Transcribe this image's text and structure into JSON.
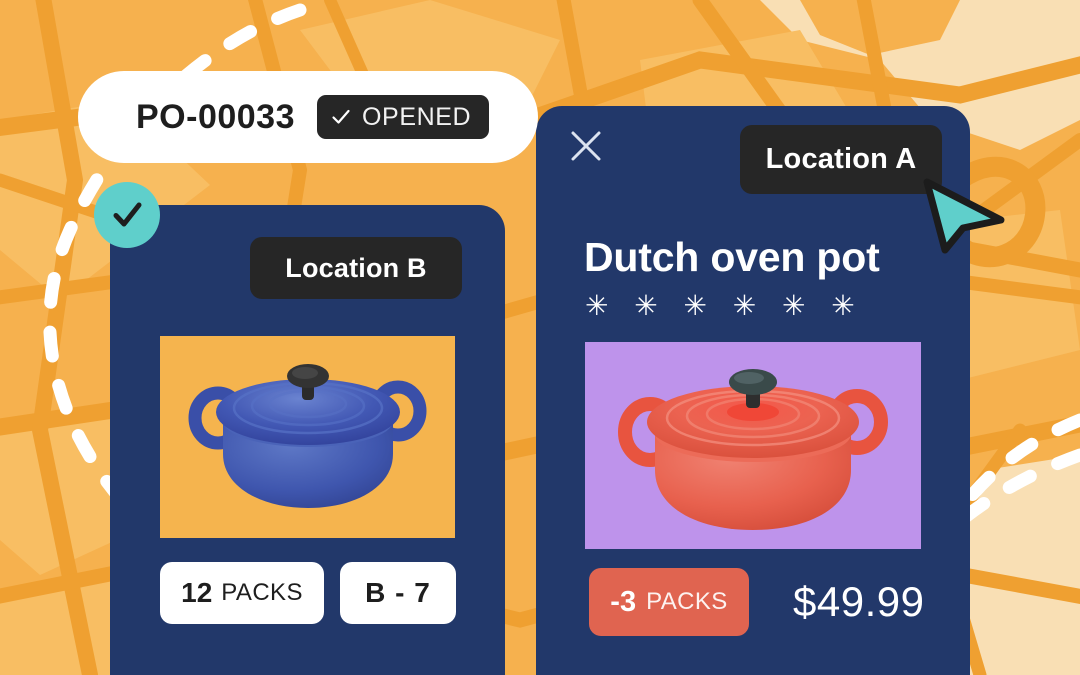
{
  "header": {
    "po_number": "PO-00033",
    "status_label": "OPENED",
    "status_icon": "check-icon",
    "status_bg": "#262626",
    "banner_bg": "#FFFFFF"
  },
  "cursor": {
    "icon": "cursor-arrow-icon",
    "fill": "#5FCFCB",
    "stroke": "#1C1C1C"
  },
  "check_marker": {
    "icon": "check-icon",
    "bg": "#5FCFCB",
    "stroke": "#1E1E1E"
  },
  "map": {
    "base_color": "#F6B14E",
    "road_color": "#EFA031",
    "block_color": "#F8BE63",
    "land_color": "#F9DFB4",
    "route_color": "#FFFFFF"
  },
  "cards": [
    {
      "id": "location-b",
      "location_label": "Location B",
      "bg": "#22386A",
      "image": {
        "name": "blue-dutch-oven-photo",
        "frame_bg": "#F5B44E",
        "pot_color": "#3A4FA8",
        "pot_body_color": "#4A63B8",
        "knob_color": "#2B2B2B"
      },
      "badges": [
        {
          "name": "packs-badge",
          "qty": "12",
          "unit": "PACKS",
          "bg": "#FFFFFF",
          "text": "#1E1E1E"
        },
        {
          "name": "bin-badge",
          "value": "B - 7",
          "bg": "#FFFFFF",
          "text": "#1E1E1E"
        }
      ]
    },
    {
      "id": "location-a",
      "location_label": "Location A",
      "bg": "#22386A",
      "close_icon": "close-icon",
      "product_title": "Dutch oven pot",
      "rating": "✳ ✳ ✳ ✳ ✳ ✳",
      "image": {
        "name": "red-dutch-oven-photo",
        "frame_bg": "#BE93EB",
        "pot_color": "#E8543F",
        "pot_body_color": "#E8614E",
        "knob_color": "#3A4A4A"
      },
      "badges": [
        {
          "name": "packs-badge",
          "qty": "-3",
          "unit": "PACKS",
          "bg": "#E06450",
          "text": "#FFFFFF"
        }
      ],
      "price": "$49.99"
    }
  ]
}
